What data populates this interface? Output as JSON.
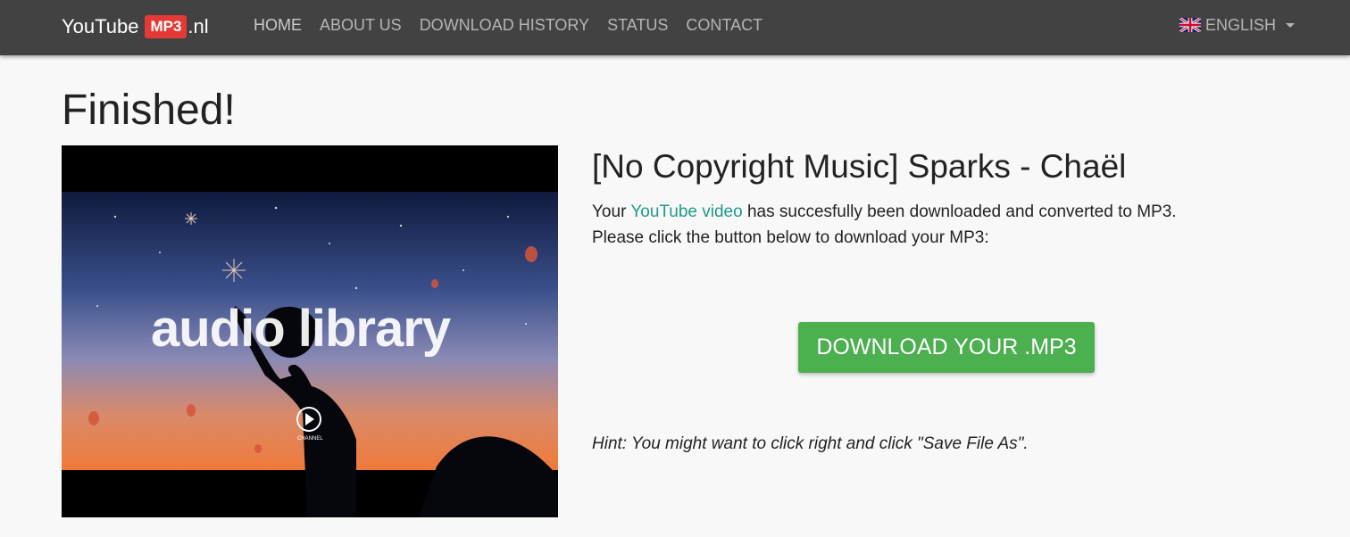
{
  "brand": {
    "prefix": "YouTube",
    "badge": "MP3",
    "suffix": ".nl"
  },
  "nav": {
    "items": [
      "HOME",
      "ABOUT US",
      "DOWNLOAD HISTORY",
      "STATUS",
      "CONTACT"
    ]
  },
  "language": {
    "label": "ENGLISH",
    "icon": "uk-flag-icon"
  },
  "page": {
    "heading": "Finished!"
  },
  "thumbnail": {
    "overlay_text": "audio library",
    "channel_text": "CHANNEL"
  },
  "video": {
    "title": "[No Copyright Music] Sparks - Chaël",
    "line1_prefix": "Your ",
    "line1_link": "YouTube video",
    "line1_suffix": " has succesfully been downloaded and converted to MP3.",
    "line2": "Please click the button below to download your MP3:"
  },
  "download_button": {
    "label": "DOWNLOAD YOUR .MP3"
  },
  "hint": "Hint: You might want to click right and click \"Save File As\".",
  "colors": {
    "navbar": "#424242",
    "badge": "#e53935",
    "link": "#21998a",
    "button": "#4caf50"
  }
}
